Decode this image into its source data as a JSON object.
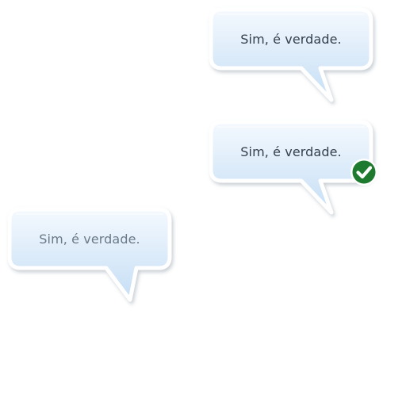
{
  "bubbles": [
    {
      "text": "Sim, é verdade.",
      "variant": "normal",
      "marked": false
    },
    {
      "text": "Sim, é verdade.",
      "variant": "normal",
      "marked": true,
      "mark_icon": "check-circle-icon",
      "mark_color": "#1e7a2e"
    },
    {
      "text": "Sim, é verdade.",
      "variant": "muted",
      "marked": false
    }
  ],
  "colors": {
    "bubble_fill_top": "#f4f9fe",
    "bubble_fill_bottom": "#c7e0f6",
    "bubble_border": "#ffffff",
    "text": "#34404d",
    "text_muted": "#6b7a88",
    "check": "#1e7a2e"
  }
}
